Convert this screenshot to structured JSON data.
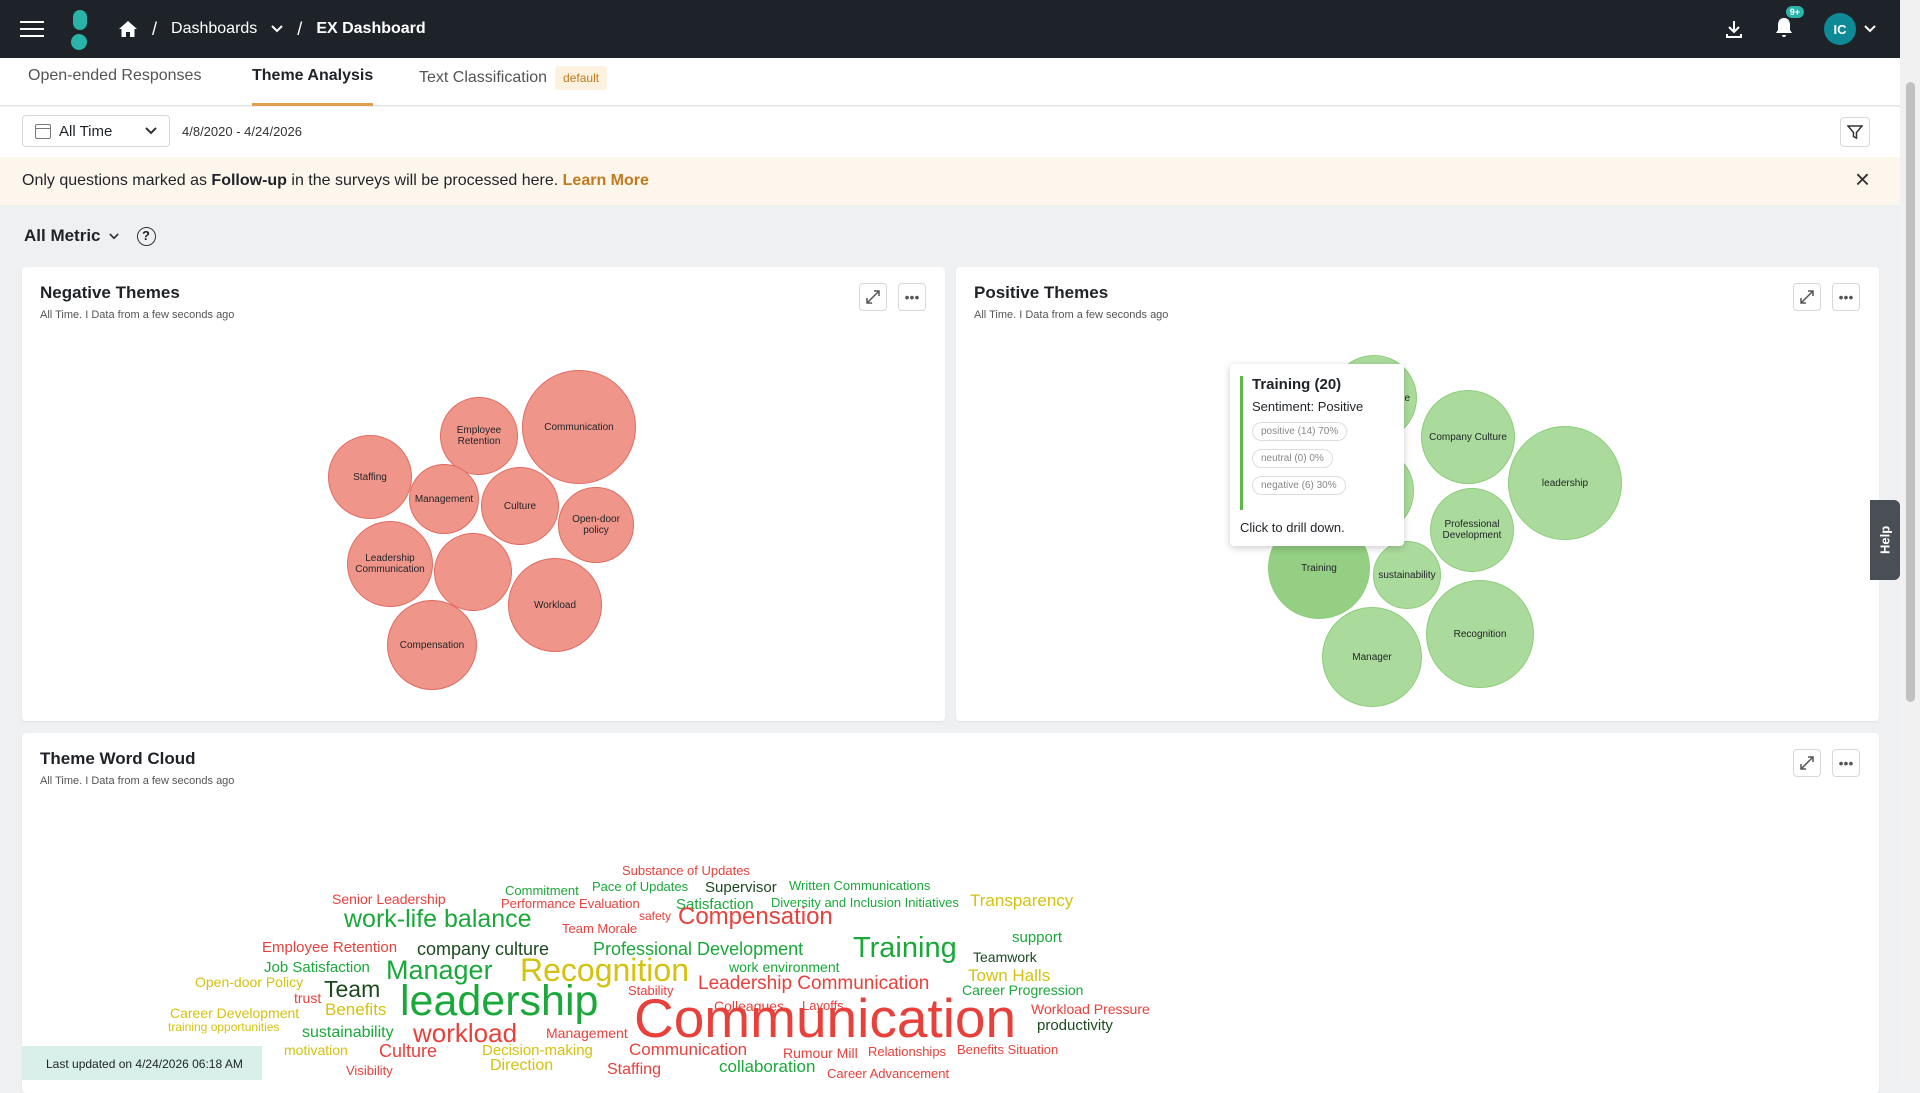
{
  "header": {
    "breadcrumb": [
      "Dashboards",
      "EX Dashboard"
    ],
    "notification_badge": "9+",
    "avatar_initials": "IC"
  },
  "tabs": [
    {
      "label": "Open-ended Responses"
    },
    {
      "label": "Theme Analysis",
      "active": true
    },
    {
      "label": "Text Classification",
      "chip": "default"
    }
  ],
  "filter": {
    "range_select": "All Time",
    "date_text": "4/8/2020 - 4/24/2026"
  },
  "notice": {
    "prefix": "Only questions marked as ",
    "bold": "Follow-up",
    "suffix": " in the surveys will be processed here. ",
    "link": "Learn More"
  },
  "metric_select": "All Metric",
  "negative_card": {
    "title": "Negative Themes",
    "subtitle": "All Time. I Data from a few seconds ago",
    "bubbles": [
      "Communication",
      "Employee Retention",
      "Staffing",
      "Management",
      "Culture",
      "Open-door policy",
      "Leadership Communication",
      "",
      "Workload",
      "Compensation"
    ]
  },
  "positive_card": {
    "title": "Positive Themes",
    "subtitle": "All Time. I Data from a few seconds ago",
    "bubbles": [
      "e",
      "Company Culture",
      "leadership",
      "Professional Development",
      "",
      "Training",
      "sustainability",
      "Manager",
      "Recognition"
    ],
    "tooltip": {
      "title": "Training (20)",
      "sentiment": "Sentiment: Positive",
      "positive": "positive (14) 70%",
      "neutral": "neutral (0) 0%",
      "negative": "negative (6) 30%",
      "drill": "Click to drill down."
    }
  },
  "wordcloud_card": {
    "title": "Theme Word Cloud",
    "subtitle": "All Time. I Data from a few seconds ago",
    "words": [
      "Substance of Updates",
      "Commitment",
      "Pace of Updates",
      "Supervisor",
      "Written Communications",
      "Senior Leadership",
      "Performance Evaluation",
      "Satisfaction",
      "Diversity and Inclusion Initiatives",
      "Transparency",
      "work-life balance",
      "safety",
      "Compensation",
      "Team Morale",
      "support",
      "Employee Retention",
      "company culture",
      "Professional Development",
      "Training",
      "Teamwork",
      "Job Satisfaction",
      "Manager",
      "Recognition",
      "work environment",
      "Town Halls",
      "Open-door Policy",
      "Team",
      "Stability",
      "Leadership Communication",
      "Career Progression",
      "trust",
      "leadership",
      "Colleagues",
      "Layoffs",
      "Career Development",
      "Benefits",
      "Communication",
      "Workload Pressure",
      "training opportunities",
      "productivity",
      "sustainability",
      "workload",
      "Management",
      "motivation",
      "Culture",
      "Decision-making",
      "Communication",
      "Rumour Mill",
      "Relationships",
      "Benefits Situation",
      "Visibility",
      "Direction",
      "Staffing",
      "collaboration",
      "Career Advancement"
    ]
  },
  "last_updated": "Last updated on 4/24/2026 06:18 AM",
  "help_label": "Help",
  "colors": {
    "negative": "#ef9589",
    "positive": "#abdb9c",
    "accent": "#c07b1f",
    "wc_red": "#e8413c",
    "wc_green": "#1aa83a",
    "wc_yellow": "#d4c20e",
    "wc_dark": "#1b4a1f"
  }
}
